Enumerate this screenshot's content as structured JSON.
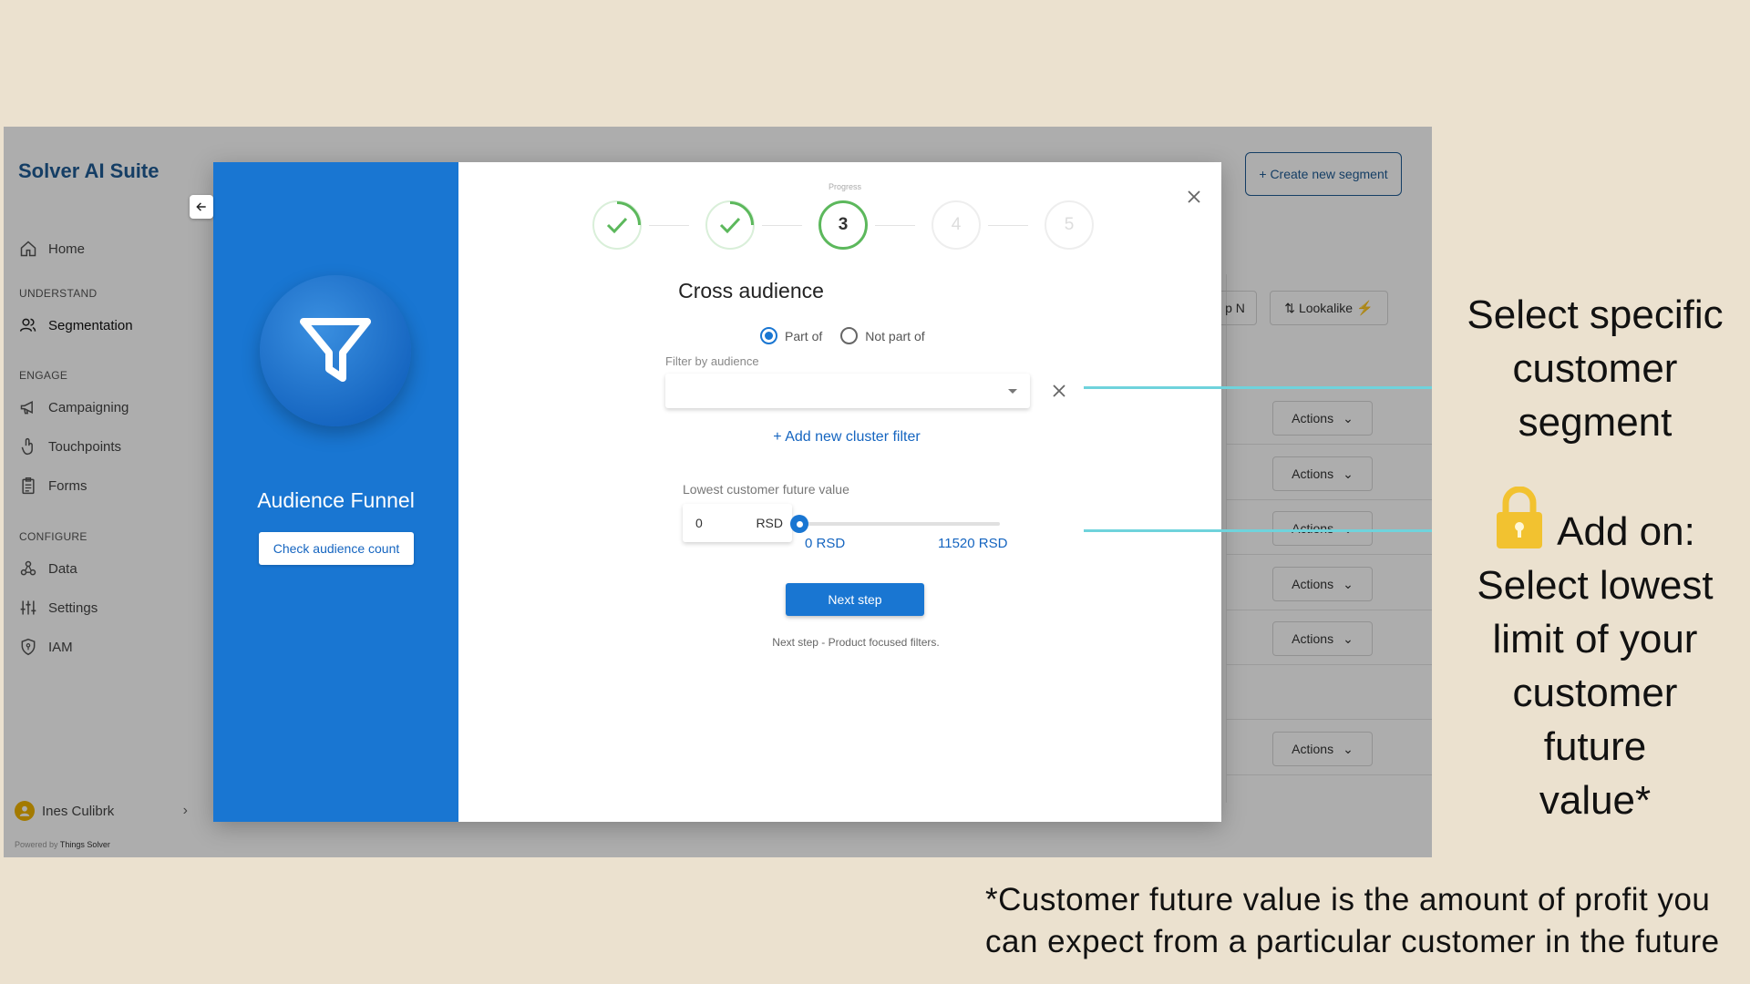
{
  "app": {
    "brand": "Solver AI Suite",
    "sections": {
      "understand": "UNDERSTAND",
      "engage": "ENGAGE",
      "configure": "CONFIGURE"
    },
    "nav": {
      "home": "Home",
      "segmentation": "Segmentation",
      "campaigning": "Campaigning",
      "touchpoints": "Touchpoints",
      "forms": "Forms",
      "data": "Data",
      "settings": "Settings",
      "iam": "IAM"
    },
    "user_name": "Ines Culibrk",
    "powered_by_prefix": "Powered by",
    "powered_by_name": "Things Solver"
  },
  "main": {
    "create_segment": "+ Create new segment",
    "chip_partial": "p N",
    "lookalike": "Lookalike",
    "actions_label": "Actions"
  },
  "modal": {
    "left_title": "Audience Funnel",
    "check_audience": "Check audience count",
    "progress_label": "Progress",
    "steps": [
      "1",
      "2",
      "3",
      "4",
      "5"
    ],
    "current_step": 3,
    "title": "Cross audience",
    "radio_part_of": "Part of",
    "radio_not_part_of": "Not part of",
    "filter_label": "Filter by audience",
    "add_cluster": "+ Add new cluster filter",
    "lcfv_label": "Lowest customer future value",
    "value": "0",
    "unit": "RSD",
    "slider_value": 0,
    "slider_max": 11520,
    "slider_min_label": "0 RSD",
    "slider_max_label": "11520 RSD",
    "next_button": "Next step",
    "next_hint": "Next step - Product focused filters."
  },
  "annotations": {
    "segment_lines": [
      "Select specific",
      "customer",
      "segment"
    ],
    "addon_first": "Add on:",
    "addon_lines": [
      "Select lowest",
      "limit of your",
      "customer",
      "future",
      "value*"
    ],
    "footnote_line1": "*Customer future value is the amount of profit you",
    "footnote_line2": "can expect from a particular customer in the future"
  },
  "colors": {
    "background": "#ebe1cf",
    "brand": "#1f5c95",
    "primary": "#1976d2",
    "success": "#5cb85c",
    "pointer": "#6fd3dc"
  }
}
